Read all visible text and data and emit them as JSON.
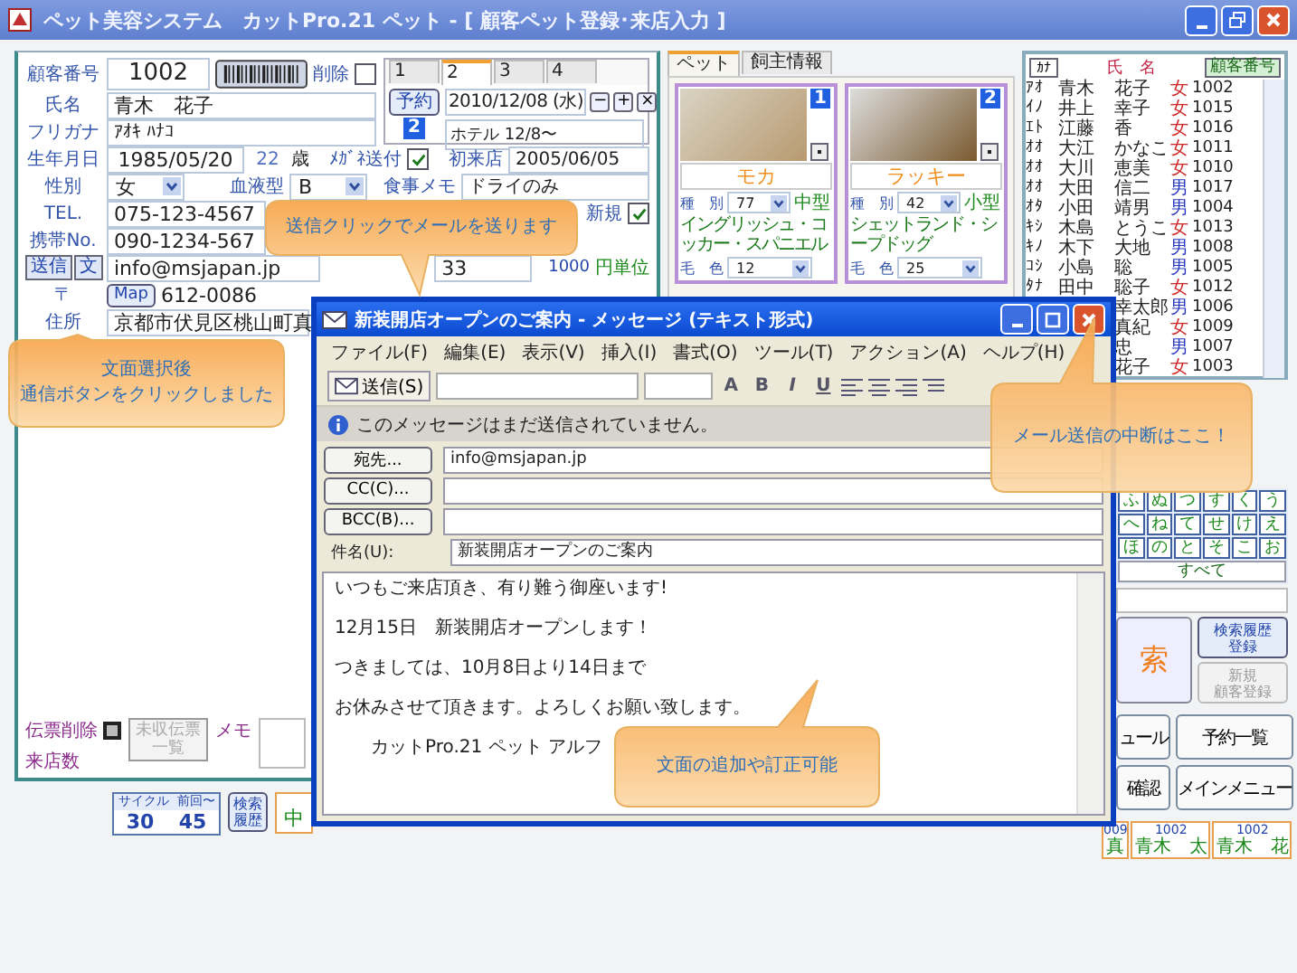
{
  "window": {
    "title": "ペット美容システム　カットPro.21 ペット - [ 顧客ペット登録･来店入力 ]"
  },
  "customer": {
    "number": {
      "label": "顧客番号",
      "value": "1002"
    },
    "delete": {
      "label": "削除",
      "checked": false
    },
    "name": {
      "label": "氏名",
      "value": "青木　花子"
    },
    "kana": {
      "label": "フリガナ",
      "value": "ｱｵｷ ﾊﾅｺ"
    },
    "birth": {
      "label": "生年月日",
      "value": "1985/05/20"
    },
    "age": {
      "value": "22",
      "unit": "歳"
    },
    "dm": {
      "label": "ﾒｶﾞﾈ送付",
      "checked": true
    },
    "first_visit": {
      "label": "初来店",
      "value": "2005/06/05"
    },
    "sex": {
      "label": "性別",
      "value": "女"
    },
    "blood": {
      "label": "血液型",
      "value": "B"
    },
    "meal": {
      "label": "食事メモ",
      "value": "ドライのみ"
    },
    "tel": {
      "label": "TEL.",
      "value": "075-123-4567"
    },
    "new": {
      "label": "新規",
      "checked": true
    },
    "mobile": {
      "label": "携帯No.",
      "value": "090-1234-567"
    },
    "send_button": "送信",
    "text_button": "文",
    "email": {
      "value": "info@msjapan.jp"
    },
    "points": {
      "value": "33"
    },
    "unit": {
      "value": "1000",
      "label": "円単位"
    },
    "zip": {
      "label": "〒",
      "button": "Map",
      "value": "612-0086"
    },
    "address": {
      "label": "住所",
      "value": "京都市伏見区桃山町真"
    }
  },
  "reservation": {
    "tabs": [
      {
        "label": "1",
        "selected": false
      },
      {
        "label": "2",
        "selected": true
      },
      {
        "label": "3",
        "selected": false
      },
      {
        "label": "4",
        "selected": false
      }
    ],
    "button": "予約",
    "count": "2",
    "date": "2010/12/08 (水)",
    "controls": [
      "−",
      "+",
      "×"
    ],
    "memo": "ホテル 12/8〜"
  },
  "pets": {
    "tabs": [
      {
        "label": "ペット",
        "selected": true
      },
      {
        "label": "飼主情報",
        "selected": false
      }
    ],
    "items": [
      {
        "number": "1",
        "name": "モカ",
        "type_label": "種　別",
        "type_code": "77",
        "size": "中型",
        "breed": "イングリッシュ・コッカー・スパニエル",
        "color_label": "毛　色",
        "color_code": "12"
      },
      {
        "number": "2",
        "name": "ラッキー",
        "type_label": "種　別",
        "type_code": "42",
        "size": "小型",
        "breed": "シェットランド・シープドッグ",
        "color_label": "毛　色",
        "color_code": "25"
      }
    ]
  },
  "customer_list": {
    "columns": [
      "ｶﾅ",
      "氏　名",
      "顧客番号"
    ],
    "rows": [
      {
        "kana": "ｱｵ",
        "family": "青木",
        "given": "花子",
        "sex": "女",
        "color": "#d02828",
        "number": "1002"
      },
      {
        "kana": "ｲﾉ",
        "family": "井上",
        "given": "幸子",
        "sex": "女",
        "color": "#d02828",
        "number": "1015"
      },
      {
        "kana": "ｴﾄ",
        "family": "江藤",
        "given": "香",
        "sex": "女",
        "color": "#d02828",
        "number": "1016"
      },
      {
        "kana": "ｵｵ",
        "family": "大江",
        "given": "かなこ",
        "sex": "女",
        "color": "#d02828",
        "number": "1011"
      },
      {
        "kana": "ｵｵ",
        "family": "大川",
        "given": "恵美",
        "sex": "女",
        "color": "#d02828",
        "number": "1010"
      },
      {
        "kana": "ｵｵ",
        "family": "大田",
        "given": "信二",
        "sex": "男",
        "color": "#2838c0",
        "number": "1017"
      },
      {
        "kana": "ｵﾀ",
        "family": "小田",
        "given": "靖男",
        "sex": "男",
        "color": "#2838c0",
        "number": "1004"
      },
      {
        "kana": "ｷｼ",
        "family": "木島",
        "given": "とうこ",
        "sex": "女",
        "color": "#d02828",
        "number": "1013"
      },
      {
        "kana": "ｷﾉ",
        "family": "木下",
        "given": "大地",
        "sex": "男",
        "color": "#2838c0",
        "number": "1008"
      },
      {
        "kana": "ｺｼ",
        "family": "小島",
        "given": "聡",
        "sex": "男",
        "color": "#2838c0",
        "number": "1005"
      },
      {
        "kana": "ﾀﾅ",
        "family": "田中",
        "given": "聡子",
        "sex": "女",
        "color": "#d02828",
        "number": "1012"
      },
      {
        "given": "幸太郎",
        "sex": "男",
        "color": "#2838c0",
        "number": "1006"
      },
      {
        "given": "真紀",
        "sex": "女",
        "color": "#d02828",
        "number": "1009"
      },
      {
        "given": "忠",
        "sex": "男",
        "color": "#2838c0",
        "number": "1007"
      },
      {
        "given": "花子",
        "sex": "女",
        "color": "#d02828",
        "number": "1003"
      }
    ]
  },
  "kana_pad": {
    "rows": [
      [
        "ふ",
        "ぬ",
        "つ",
        "す",
        "く",
        "う"
      ],
      [
        "へ",
        "ね",
        "て",
        "せ",
        "け",
        "え"
      ],
      [
        "ほ",
        "の",
        "と",
        "そ",
        "こ",
        "お"
      ]
    ],
    "all": "すべて"
  },
  "search": {
    "search_button": "索",
    "history_button": [
      "検索履歴",
      "登録"
    ],
    "new_button": [
      "新規",
      "顧客登録"
    ],
    "new_disabled": true
  },
  "menu_buttons": [
    "ュール",
    "予約一覧",
    "確認",
    "メインメニュー"
  ],
  "recent": [
    {
      "number": "009",
      "name": "真"
    },
    {
      "number": "1002",
      "name": "青木　太"
    },
    {
      "number": "1002",
      "name": "青木　花"
    }
  ],
  "footer": {
    "slip_delete": "伝票削除",
    "unpaid_button": [
      "未収伝票",
      "一覧"
    ],
    "unpaid_disabled": true,
    "memo_label": "メモ",
    "visits_label": "来店数",
    "cycle_label": "サイクル",
    "cycle": "30",
    "last_label": "前回〜",
    "last": "45",
    "history_button": [
      "検索",
      "履歴"
    ],
    "partial": "中"
  },
  "message_window": {
    "title": "新装開店オープンのご案内 - メッセージ (テキスト形式)",
    "menu": [
      "ファイル(F)",
      "編集(E)",
      "表示(V)",
      "挿入(I)",
      "書式(O)",
      "ツール(T)",
      "アクション(A)",
      "ヘルプ(H)"
    ],
    "send_button": "送信(S)",
    "format_buttons": [
      "A",
      "B",
      "I",
      "U"
    ],
    "info": "このメッセージはまだ送信されていません。",
    "to_button": "宛先...",
    "to": "info@msjapan.jp",
    "cc_button": "CC(C)...",
    "bcc_button": "BCC(B)...",
    "subject_label": "件名(U):",
    "subject": "新装開店オープンのご案内",
    "body": [
      "いつもご来店頂き、有り難う御座います!",
      "12月15日　新装開店オープンします！",
      "つきましては、10月8日より14日まで",
      "お休みさせて頂きます。よろしくお願い致します。",
      "カットPro.21 ペット アルフ"
    ]
  },
  "callouts": [
    [
      "送信クリックでメールを送ります"
    ],
    [
      "文面選択後",
      "通信ボタンをクリックしました"
    ],
    [
      "メール送信の中断はここ！"
    ],
    [
      "文面の追加や訂正可能"
    ]
  ]
}
